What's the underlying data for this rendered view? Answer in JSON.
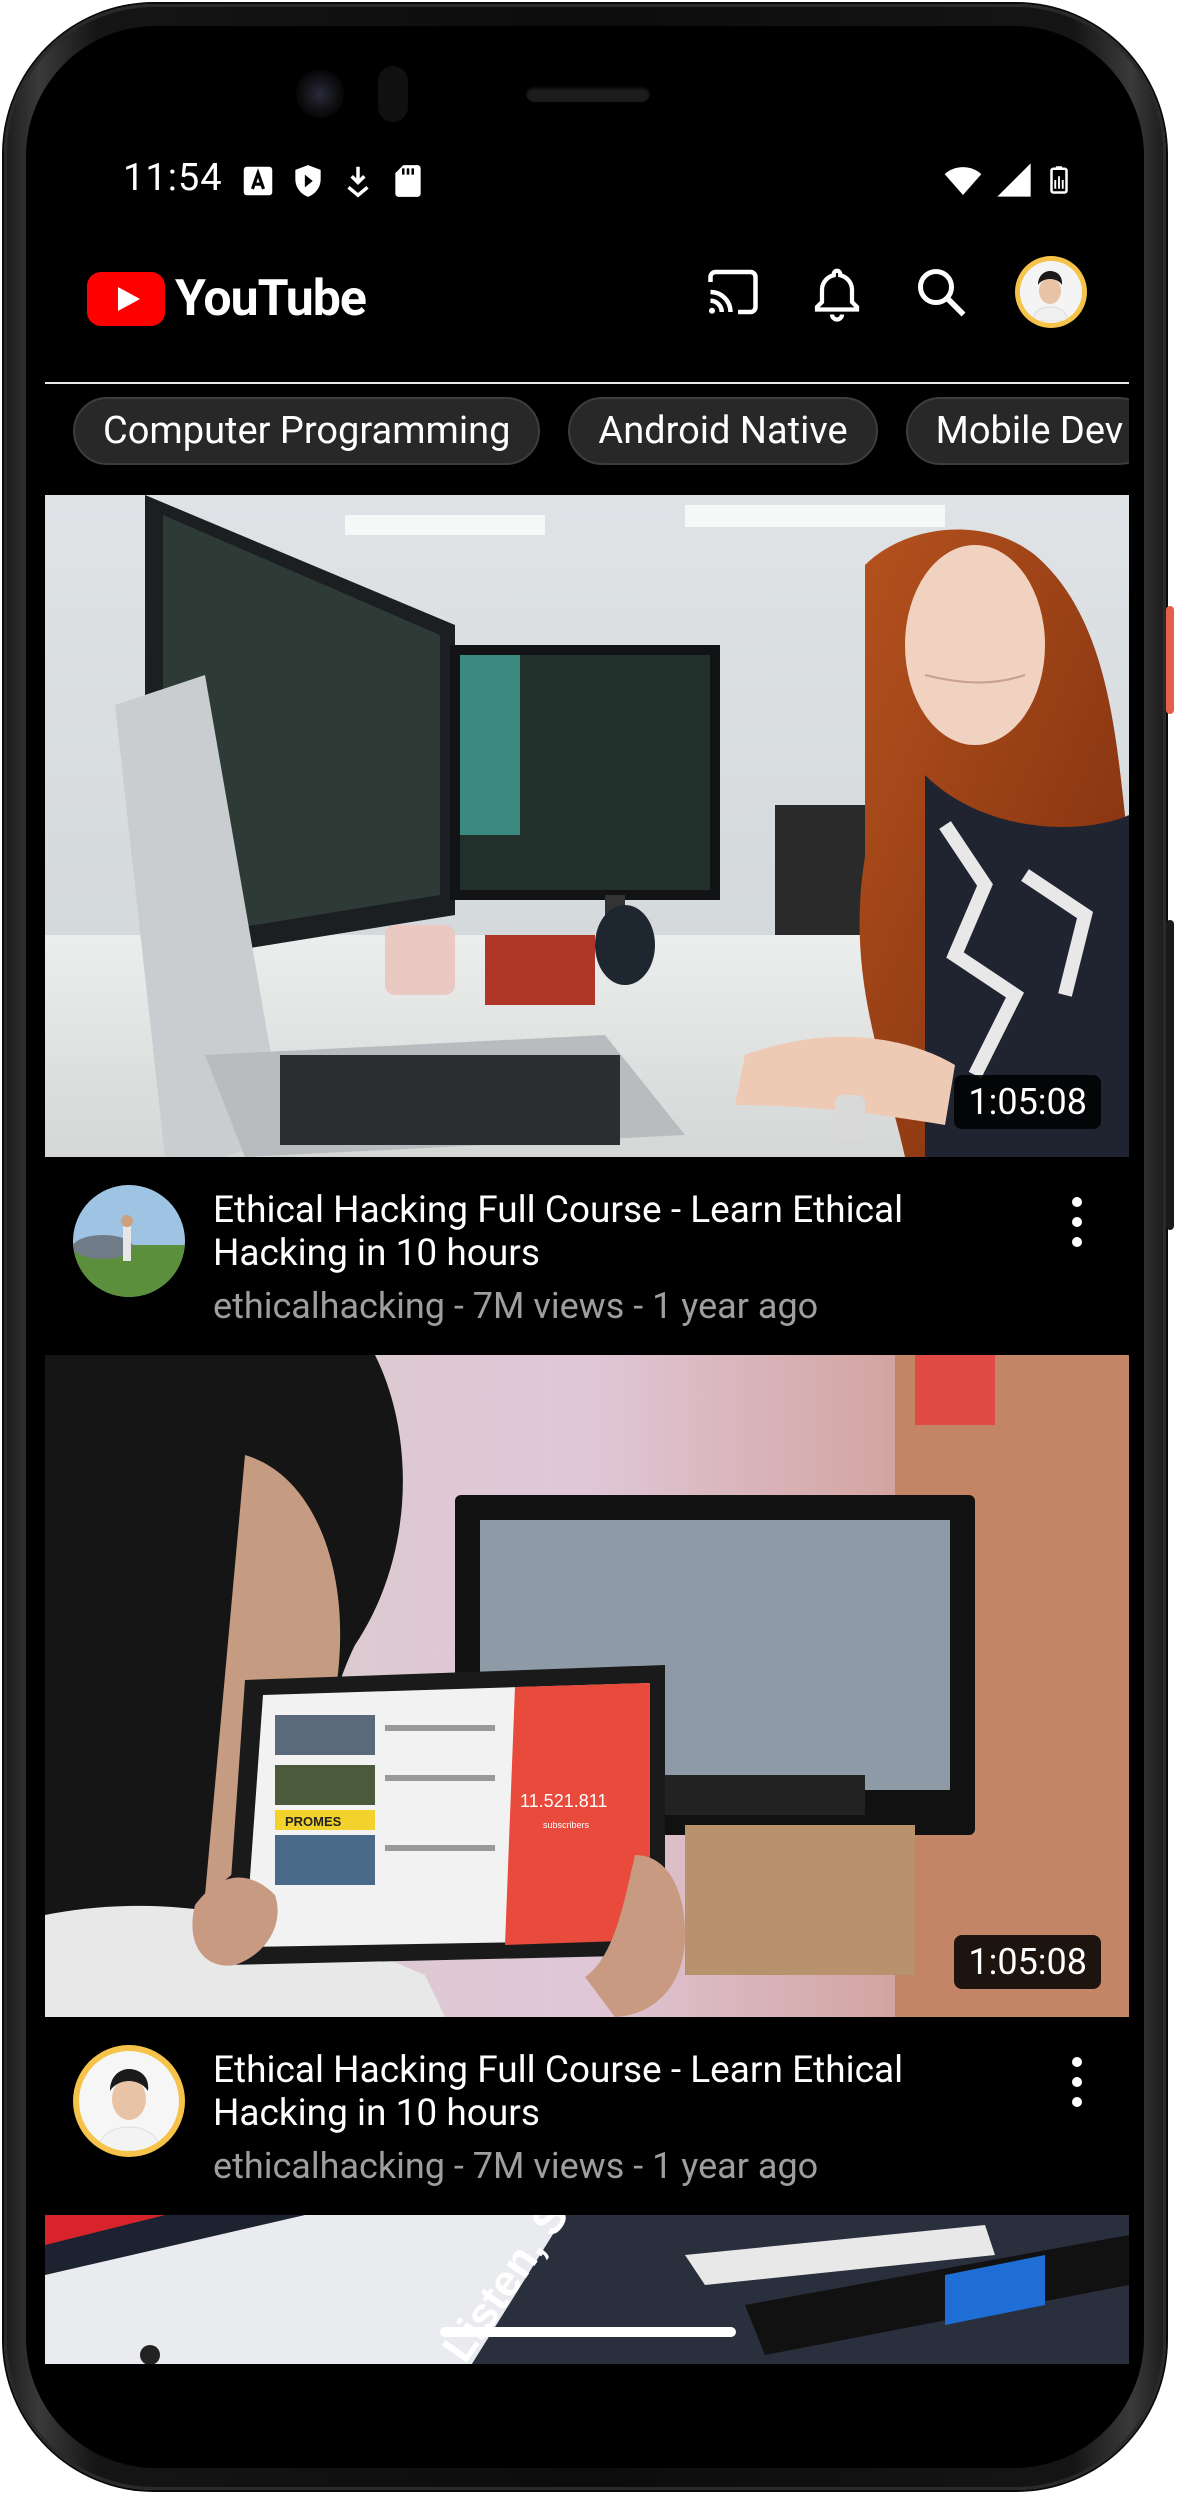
{
  "status": {
    "time": "11:54"
  },
  "app": {
    "brand": "YouTube"
  },
  "chips": [
    "Computer Programming",
    "Android Native",
    "Mobile Dev"
  ],
  "videos": [
    {
      "title": "Ethical Hacking Full Course - Learn Ethical Hacking in 10 hours",
      "meta": "ethicalhacking - 7M views - 1 year ago",
      "duration": "1:05:08"
    },
    {
      "title": "Ethical Hacking Full Course - Learn Ethical Hacking in 10 hours",
      "meta": "ethicalhacking - 7M views - 1 year ago",
      "duration": "1:05:08"
    }
  ],
  "tablet_screen": {
    "count": "11.521.811",
    "caption": "subscribers",
    "banner": "PROMES"
  },
  "poster_text": "Listen, Stream",
  "colors": {
    "brand_red": "#ff0000",
    "chip_bg": "#282828",
    "background": "#000000",
    "secondary_text": "#9e9e9e",
    "avatar_ring": "#f6c34a"
  }
}
